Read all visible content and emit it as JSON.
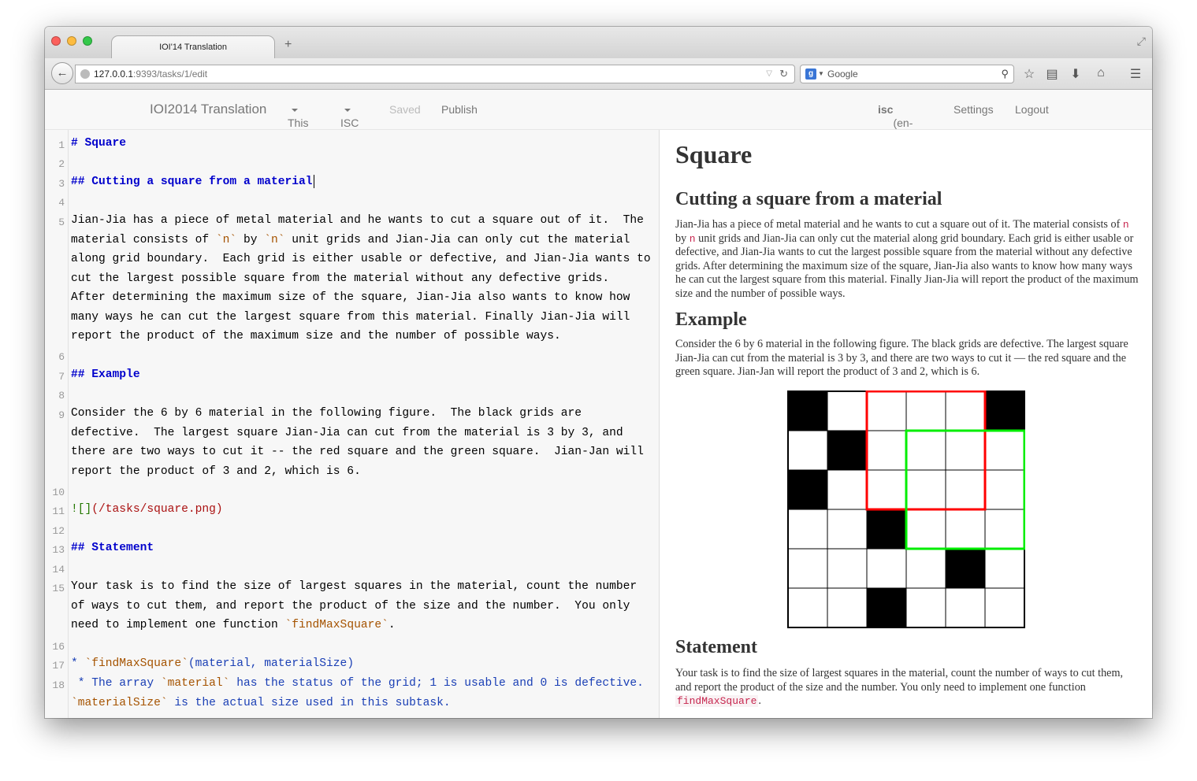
{
  "browser": {
    "tab_title": "IOI'14 Translation",
    "new_tab": "+",
    "back": "←",
    "url_host": "127.0.0.1",
    "url_rest": ":9393/tasks/1/edit",
    "reload": "↻",
    "search_engine_badge": "g",
    "search_placeholder": "Google",
    "icons": [
      "star-icon",
      "reading-list-icon",
      "download-icon",
      "home-icon",
      "menu-icon"
    ]
  },
  "nav": {
    "brand": "IOI2014 Translation",
    "this": "This",
    "isc": "ISC",
    "saved": "Saved",
    "publish": "Publish",
    "user_bold": "isc",
    "user_lang": " (en-ISC)",
    "settings": "Settings",
    "logout": "Logout"
  },
  "editor": {
    "line_numbers": [
      "1",
      "2",
      "3",
      "4",
      "5",
      "6",
      "7",
      "8",
      "9",
      "10",
      "11",
      "12",
      "13",
      "14",
      "15",
      "16",
      "17",
      "18"
    ],
    "l1": "# Square",
    "l3": "## Cutting a square from a material",
    "l5a": "Jian-Jia has a piece of metal material and he wants to cut a square out of it.  The material consists of ",
    "l5_code1": "`n`",
    "l5b": " by ",
    "l5_code2": "`n`",
    "l5c": " unit grids and Jian-Jia can only cut the material along grid boundary.  Each grid is either usable or defective, and Jian-Jia wants to cut the largest possible square from the material without any defective grids.  After determining the maximum size of the square, Jian-Jia also wants to know how many ways he can cut the largest square from this material. Finally Jian-Jia will report the product of the maximum size and the number of possible ways.",
    "l7": "## Example",
    "l9": "Consider the 6 by 6 material in the following figure.  The black grids are defective.  The largest square Jian-Jia can cut from the material is 3 by 3, and there are two ways to cut it -- the red square and the green square.  Jian-Jan will report the product of 3 and 2, which is 6.",
    "l11a": "![]",
    "l11b": "(/tasks/square.png)",
    "l13": "## Statement",
    "l15a": "Your task is to find the size of largest squares in the material, count the number of ways to cut them, and report the product of the size and the number.  You only need to implement one function ",
    "l15_code": "`findMaxSquare`",
    "l15b": ".",
    "l17a": "* ",
    "l17_code": "`findMaxSquare`",
    "l17b": "(material, materialSize)",
    "l18a": " * The array ",
    "l18_code1": "`material`",
    "l18b": " has the status of the grid; 1 is usable and 0 is defective. ",
    "l18_code2": "`materialSize`",
    "l18c": " is the actual size used in this subtask."
  },
  "preview": {
    "h1": "Square",
    "h2_cutting": "Cutting a square from a material",
    "p1a": "Jian-Jia has a piece of metal material and he wants to cut a square out of it. The material consists of ",
    "p1_n1": "n",
    "p1b": " by ",
    "p1_n2": "n",
    "p1c": " unit grids and Jian-Jia can only cut the material along grid boundary. Each grid is either usable or defective, and Jian-Jia wants to cut the largest possible square from the material without any defective grids. After determining the maximum size of the square, Jian-Jia also wants to know how many ways he can cut the largest square from this material. Finally Jian-Jia will report the product of the maximum size and the number of possible ways.",
    "h2_example": "Example",
    "p2": "Consider the 6 by 6 material in the following figure. The black grids are defective. The largest square Jian-Jia can cut from the material is 3 by 3, and there are two ways to cut it — the red square and the green square. Jian-Jan will report the product of 3 and 2, which is 6.",
    "h2_statement": "Statement",
    "p3a": "Your task is to find the size of largest squares in the material, count the number of ways to cut them, and report the product of the size and the number. You only need to implement one function ",
    "p3_code": "findMaxSquare",
    "p3b": ".",
    "grid": {
      "size": 6,
      "defective": [
        [
          0,
          0
        ],
        [
          0,
          5
        ],
        [
          1,
          1
        ],
        [
          2,
          0
        ],
        [
          3,
          2
        ],
        [
          4,
          4
        ],
        [
          5,
          2
        ]
      ],
      "red_square": {
        "row": 0,
        "col": 2,
        "size": 3,
        "color": "#ff0000"
      },
      "green_square": {
        "row": 1,
        "col": 3,
        "size": 3,
        "color": "#00ee00"
      }
    }
  }
}
